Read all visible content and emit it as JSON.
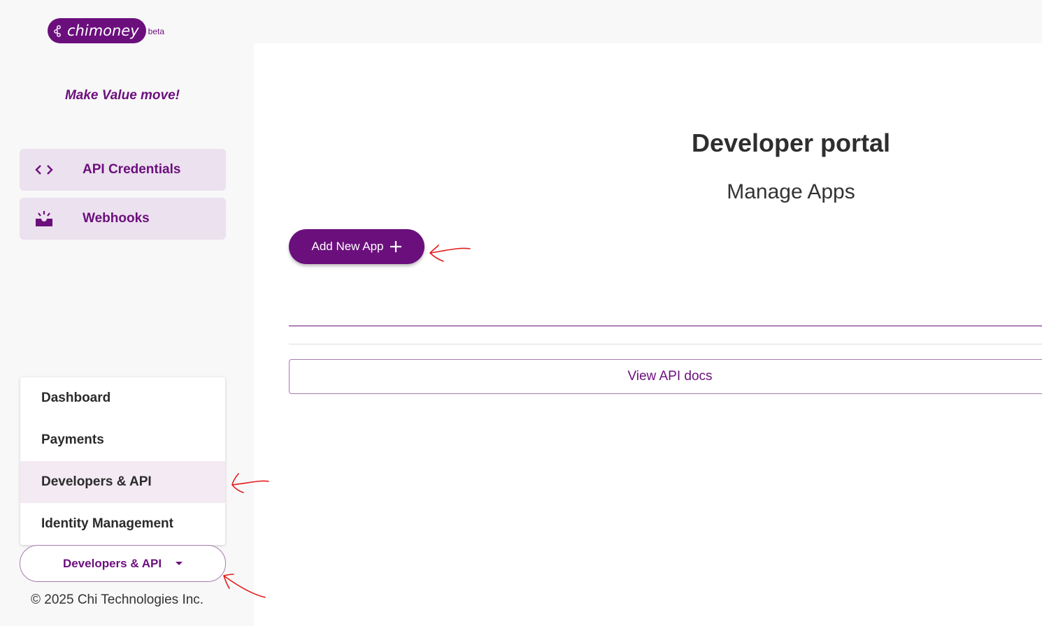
{
  "brand": {
    "name": "chimoney",
    "badge": "beta",
    "tagline": "Make Value move!"
  },
  "sidebar": {
    "nav": [
      {
        "label": "API Credentials",
        "icon": "code-brackets-icon"
      },
      {
        "label": "Webhooks",
        "icon": "webhook-icon"
      }
    ],
    "menu": [
      {
        "label": "Dashboard"
      },
      {
        "label": "Payments"
      },
      {
        "label": "Developers & API"
      },
      {
        "label": "Identity Management"
      }
    ],
    "selector": {
      "label": "Developers & API"
    },
    "footer": "© 2025 Chi Technologies Inc."
  },
  "main": {
    "title": "Developer portal",
    "subtitle": "Manage Apps",
    "add_button": "Add New App",
    "docs_button": "View API docs"
  },
  "colors": {
    "brand": "#6b0f7d",
    "nav_bg": "#ece1ee",
    "annotation": "#e31b1b"
  }
}
